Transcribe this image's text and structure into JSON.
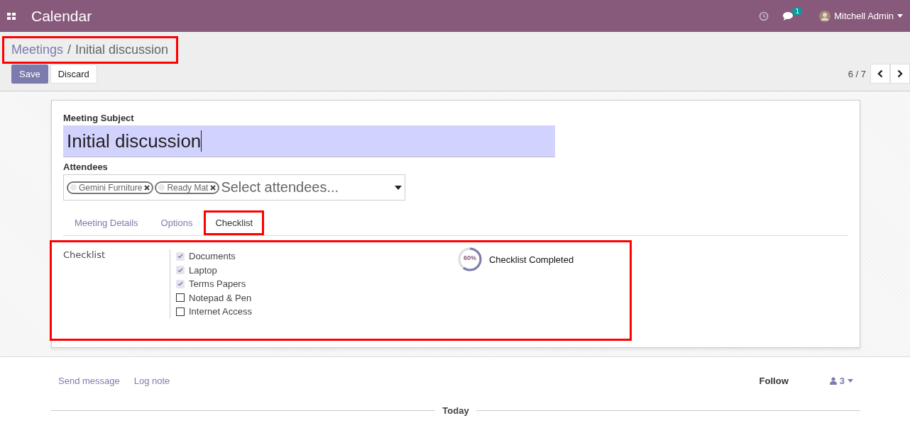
{
  "navbar": {
    "app_name": "Calendar",
    "message_count": "1",
    "user_name": "Mitchell Admin"
  },
  "breadcrumb": {
    "parent": "Meetings",
    "separator": "/",
    "current": "Initial discussion"
  },
  "buttons": [
    {
      "label": "Save",
      "kind": "primary"
    },
    {
      "label": "Discard",
      "kind": "secondary"
    }
  ],
  "pager": {
    "value": "6 / 7"
  },
  "form": {
    "subject_label": "Meeting Subject",
    "subject_value": "Initial discussion",
    "attendees_label": "Attendees",
    "attendees": [
      {
        "name": "Gemini Furniture"
      },
      {
        "name": "Ready Mat"
      }
    ],
    "attendees_placeholder": "Select attendees...",
    "tabs": [
      {
        "label": "Meeting Details",
        "selected": false,
        "highlighted": false
      },
      {
        "label": "Options",
        "selected": false,
        "highlighted": false
      },
      {
        "label": "Checklist",
        "selected": true,
        "highlighted": true
      }
    ],
    "checklist_label": "Checklist",
    "checklist": [
      {
        "label": "Documents",
        "checked": true
      },
      {
        "label": "Laptop",
        "checked": true
      },
      {
        "label": "Terms Papers",
        "checked": true
      },
      {
        "label": "Notepad & Pen",
        "checked": false
      },
      {
        "label": "Internet Access",
        "checked": false
      }
    ],
    "progress": {
      "level": 0.6,
      "reading": "60%",
      "label": "Checklist Completed"
    }
  },
  "chatter": {
    "send_message": "Send message",
    "log_note": "Log note",
    "follow": "Follow",
    "followers": "3",
    "date_separator": "Today"
  }
}
